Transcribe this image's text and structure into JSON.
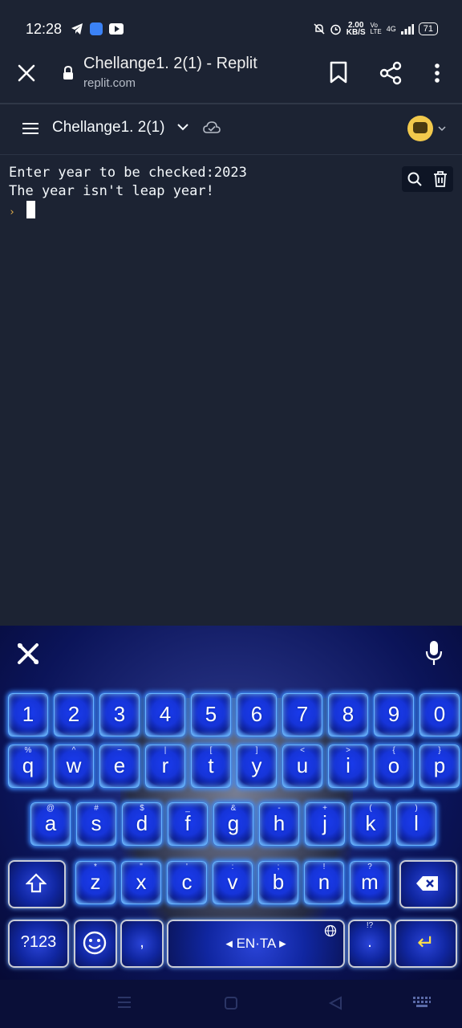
{
  "status_bar": {
    "time": "12:28",
    "net_speed_top": "2.00",
    "net_speed_bottom": "KB/S",
    "network": "4G",
    "battery": "71",
    "icons": [
      "telegram-icon",
      "app-icon",
      "youtube-icon",
      "mute-icon",
      "alarm-icon",
      "volte-icon",
      "signal-icon",
      "battery-icon"
    ]
  },
  "browser": {
    "page_title": "Chellange1. 2(1) - Replit",
    "url": "replit.com",
    "icons": [
      "close-icon",
      "lock-icon",
      "bookmark-icon",
      "share-icon",
      "more-icon"
    ]
  },
  "repl_header": {
    "repl_name": "Chellange1. 2(1)",
    "icons": [
      "menu-icon",
      "chevron-down-icon",
      "cloud-check-icon",
      "avatar"
    ]
  },
  "console": {
    "lines": [
      "Enter year to be checked:2023",
      "The year isn't leap year!"
    ],
    "prompt_symbol": "›",
    "tools": [
      "search-icon",
      "trash-icon"
    ]
  },
  "keyboard": {
    "number_row": [
      "1",
      "2",
      "3",
      "4",
      "5",
      "6",
      "7",
      "8",
      "9",
      "0"
    ],
    "row1": [
      {
        "k": "q",
        "alt": "%"
      },
      {
        "k": "w",
        "alt": "^"
      },
      {
        "k": "e",
        "alt": "~"
      },
      {
        "k": "r",
        "alt": "|"
      },
      {
        "k": "t",
        "alt": "["
      },
      {
        "k": "y",
        "alt": "]"
      },
      {
        "k": "u",
        "alt": "<"
      },
      {
        "k": "i",
        "alt": ">"
      },
      {
        "k": "o",
        "alt": "{"
      },
      {
        "k": "p",
        "alt": "}"
      }
    ],
    "row2": [
      {
        "k": "a",
        "alt": "@"
      },
      {
        "k": "s",
        "alt": "#"
      },
      {
        "k": "d",
        "alt": "$"
      },
      {
        "k": "f",
        "alt": "_"
      },
      {
        "k": "g",
        "alt": "&"
      },
      {
        "k": "h",
        "alt": "-"
      },
      {
        "k": "j",
        "alt": "+"
      },
      {
        "k": "k",
        "alt": "("
      },
      {
        "k": "l",
        "alt": ")"
      }
    ],
    "row3": [
      {
        "k": "z",
        "alt": "*"
      },
      {
        "k": "x",
        "alt": "\""
      },
      {
        "k": "c",
        "alt": "'"
      },
      {
        "k": "v",
        "alt": ":"
      },
      {
        "k": "b",
        "alt": ";"
      },
      {
        "k": "n",
        "alt": "!"
      },
      {
        "k": "m",
        "alt": "?"
      }
    ],
    "symbols_label": "?123",
    "comma_label": ",",
    "space_label": "◂ EN·TA ▸",
    "period_label": ".",
    "period_alt": "!?",
    "enter_label": "↵",
    "icons": [
      "tools-icon",
      "mic-icon",
      "shift-icon",
      "backspace-icon",
      "emoji-icon",
      "globe-icon"
    ]
  },
  "nav_bar": {
    "icons": [
      "recents-icon",
      "home-icon",
      "back-icon",
      "keyboard-hide-icon"
    ]
  }
}
